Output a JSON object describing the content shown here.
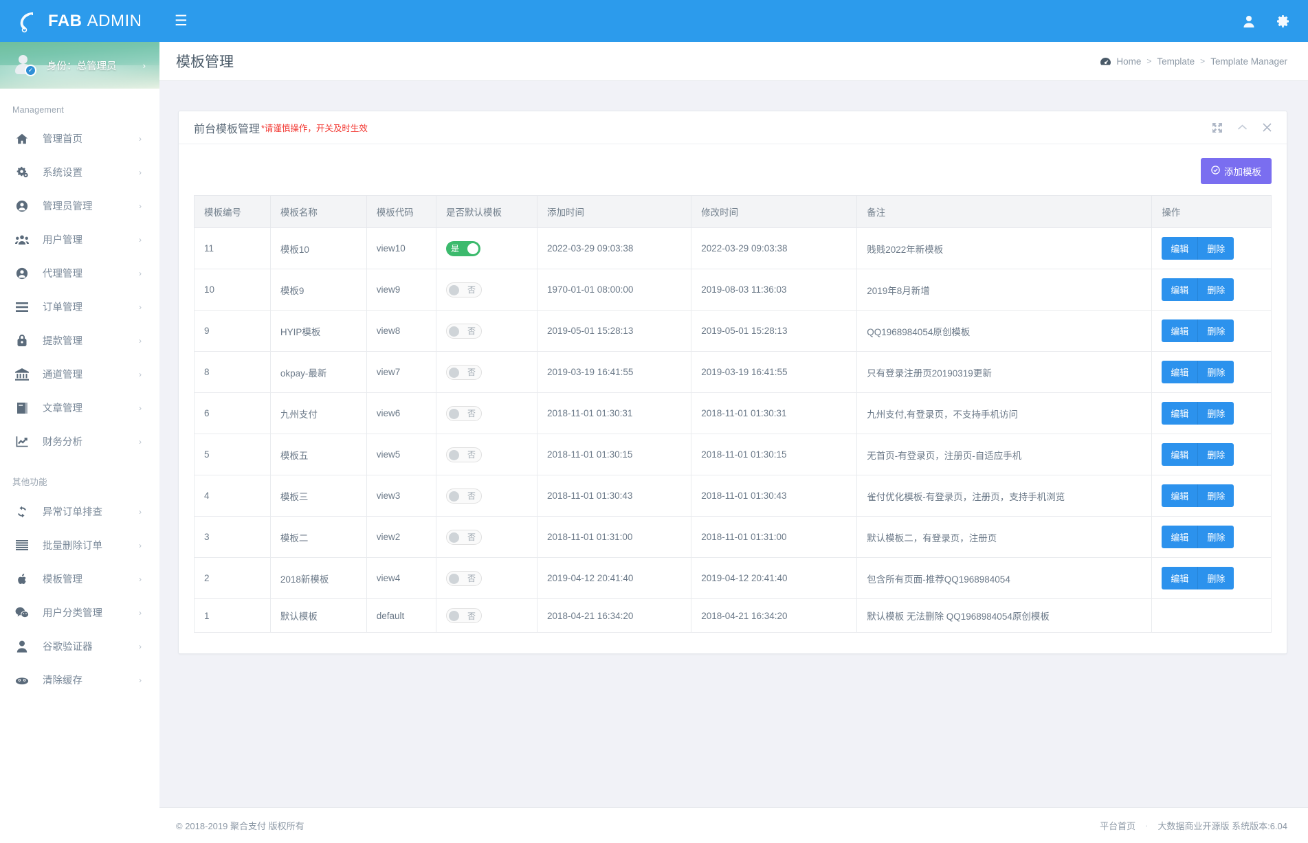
{
  "topbar": {
    "brand_bold": "FAB",
    "brand_light": "ADMIN",
    "logo_icon": "leaf-f-logo-icon",
    "menu_toggle_icon": "hamburger-icon",
    "user_icon": "user-icon",
    "settings_icon": "gear-icon",
    "accent_color": "#2c9bec"
  },
  "sidebar": {
    "profile": {
      "label": "身份：总管理员",
      "avatar_icon": "avatar-verified-icon",
      "arrow_icon": "chevron-right-icon"
    },
    "section_management": "Management",
    "section_other": "其他功能",
    "management_items": [
      {
        "label": "管理首页",
        "icon": "home-icon"
      },
      {
        "label": "系统设置",
        "icon": "gears-icon"
      },
      {
        "label": "管理员管理",
        "icon": "user-circle-icon"
      },
      {
        "label": "用户管理",
        "icon": "users-icon"
      },
      {
        "label": "代理管理",
        "icon": "user-circle-icon"
      },
      {
        "label": "订单管理",
        "icon": "list-icon"
      },
      {
        "label": "提款管理",
        "icon": "lock-icon"
      },
      {
        "label": "通道管理",
        "icon": "bank-icon"
      },
      {
        "label": "文章管理",
        "icon": "book-icon"
      },
      {
        "label": "财务分析",
        "icon": "chart-line-icon"
      }
    ],
    "other_items": [
      {
        "label": "异常订单排查",
        "icon": "refresh-icon"
      },
      {
        "label": "批量删除订单",
        "icon": "lines-icon"
      },
      {
        "label": "模板管理",
        "icon": "apple-icon"
      },
      {
        "label": "用户分类管理",
        "icon": "wechat-icon"
      },
      {
        "label": "谷歌验证器",
        "icon": "person-icon"
      },
      {
        "label": "清除缓存",
        "icon": "cloud-icon"
      }
    ]
  },
  "page": {
    "title": "模板管理",
    "breadcrumb": {
      "icon": "dashboard-icon",
      "items": [
        "Home",
        "Template",
        "Template Manager"
      ],
      "separator": ">"
    }
  },
  "card": {
    "title": "前台模板管理",
    "warning": "*请谨慎操作，开关及时生效",
    "warning_color": "#f2352f",
    "tools": [
      {
        "name": "expand-icon",
        "glyph": "expand"
      },
      {
        "name": "collapse-icon",
        "glyph": "chevron-up"
      },
      {
        "name": "close-icon",
        "glyph": "times"
      }
    ],
    "add_button": {
      "label": "添加模板",
      "icon": "check-circle-icon",
      "color": "#7a6ef0"
    }
  },
  "table": {
    "columns": [
      "模板编号",
      "模板名称",
      "模板代码",
      "是否默认模板",
      "添加时间",
      "修改时间",
      "备注",
      "操作"
    ],
    "toggle_on_label": "是",
    "toggle_off_label": "否",
    "toggle_on_color": "#3cba6d",
    "action_edit": "编辑",
    "action_delete": "删除",
    "rows": [
      {
        "id": "11",
        "name": "模板10",
        "code": "view10",
        "is_default": true,
        "added": "2022-03-29 09:03:38",
        "modified": "2022-03-29 09:03:38",
        "note": "贱贱2022年新模板",
        "has_actions": true
      },
      {
        "id": "10",
        "name": "模板9",
        "code": "view9",
        "is_default": false,
        "added": "1970-01-01 08:00:00",
        "modified": "2019-08-03 11:36:03",
        "note": "2019年8月新增",
        "has_actions": true
      },
      {
        "id": "9",
        "name": "HYIP模板",
        "code": "view8",
        "is_default": false,
        "added": "2019-05-01 15:28:13",
        "modified": "2019-05-01 15:28:13",
        "note": "QQ1968984054原创模板",
        "has_actions": true
      },
      {
        "id": "8",
        "name": "okpay-最新",
        "code": "view7",
        "is_default": false,
        "added": "2019-03-19 16:41:55",
        "modified": "2019-03-19 16:41:55",
        "note": "只有登录注册页20190319更新",
        "has_actions": true
      },
      {
        "id": "6",
        "name": "九州支付",
        "code": "view6",
        "is_default": false,
        "added": "2018-11-01 01:30:31",
        "modified": "2018-11-01 01:30:31",
        "note": "九州支付,有登录页，不支持手机访问",
        "has_actions": true
      },
      {
        "id": "5",
        "name": "模板五",
        "code": "view5",
        "is_default": false,
        "added": "2018-11-01 01:30:15",
        "modified": "2018-11-01 01:30:15",
        "note": "无首页-有登录页，注册页-自适应手机",
        "has_actions": true
      },
      {
        "id": "4",
        "name": "模板三",
        "code": "view3",
        "is_default": false,
        "added": "2018-11-01 01:30:43",
        "modified": "2018-11-01 01:30:43",
        "note": "雀付优化模板-有登录页，注册页，支持手机浏览",
        "has_actions": true
      },
      {
        "id": "3",
        "name": "模板二",
        "code": "view2",
        "is_default": false,
        "added": "2018-11-01 01:31:00",
        "modified": "2018-11-01 01:31:00",
        "note": "默认模板二，有登录页，注册页",
        "has_actions": true
      },
      {
        "id": "2",
        "name": "2018新模板",
        "code": "view4",
        "is_default": false,
        "added": "2019-04-12 20:41:40",
        "modified": "2019-04-12 20:41:40",
        "note": "包含所有页面-推荐QQ1968984054",
        "has_actions": true
      },
      {
        "id": "1",
        "name": "默认模板",
        "code": "default",
        "is_default": false,
        "added": "2018-04-21 16:34:20",
        "modified": "2018-04-21 16:34:20",
        "note": "默认模板 无法删除 QQ1968984054原创模板",
        "has_actions": false
      }
    ]
  },
  "footer": {
    "copyright": "© 2018-2019 聚合支付 版权所有",
    "home_link": "平台首页",
    "dot": "·",
    "version": "大数据商业开源版 系统版本:6.04"
  }
}
